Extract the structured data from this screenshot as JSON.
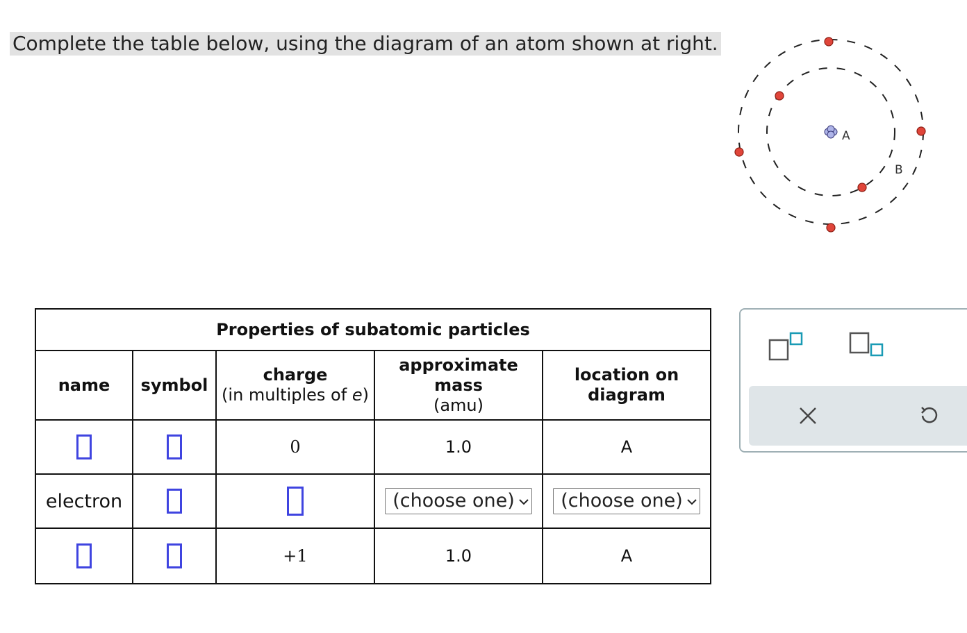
{
  "prompt": "Complete the table below, using the diagram of an atom shown at right.",
  "diagram": {
    "labels": [
      "A",
      "B"
    ],
    "icons": [
      "nucleus-icon",
      "electron-dot-icon"
    ]
  },
  "table": {
    "caption": "Properties of subatomic particles",
    "headers": {
      "name": "name",
      "symbol": "symbol",
      "charge": "charge",
      "charge_sub": "(in multiples of ",
      "charge_unit": "e",
      "charge_close": ")",
      "mass": "approximate mass",
      "mass_sub": "(amu)",
      "location": "location on diagram"
    },
    "rows": [
      {
        "name": "",
        "symbol": "",
        "charge": "0",
        "mass": "1.0",
        "location": "A"
      },
      {
        "name": "electron",
        "symbol": "",
        "charge": "",
        "mass": "(choose one)",
        "location": "(choose one)"
      },
      {
        "name": "",
        "symbol": "",
        "charge": "+1",
        "mass": "1.0",
        "location": "A"
      }
    ]
  },
  "toolbar": {
    "buttons": [
      "superscript-icon",
      "subscript-icon",
      "clear-icon",
      "undo-icon"
    ]
  },
  "colors": {
    "input_border": "#3f44e0",
    "tool_accent": "#1a9bb5",
    "electron": "#e0453a"
  }
}
